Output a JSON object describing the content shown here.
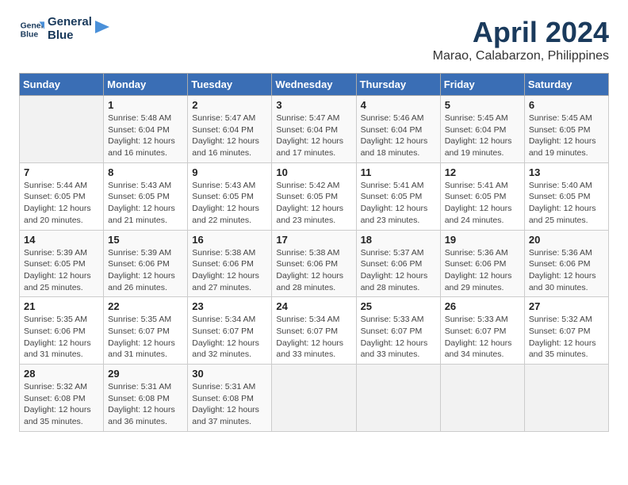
{
  "header": {
    "logo_line1": "General",
    "logo_line2": "Blue",
    "title": "April 2024",
    "subtitle": "Marao, Calabarzon, Philippines"
  },
  "calendar": {
    "days_of_week": [
      "Sunday",
      "Monday",
      "Tuesday",
      "Wednesday",
      "Thursday",
      "Friday",
      "Saturday"
    ],
    "weeks": [
      [
        {
          "day": "",
          "info": ""
        },
        {
          "day": "1",
          "info": "Sunrise: 5:48 AM\nSunset: 6:04 PM\nDaylight: 12 hours\nand 16 minutes."
        },
        {
          "day": "2",
          "info": "Sunrise: 5:47 AM\nSunset: 6:04 PM\nDaylight: 12 hours\nand 16 minutes."
        },
        {
          "day": "3",
          "info": "Sunrise: 5:47 AM\nSunset: 6:04 PM\nDaylight: 12 hours\nand 17 minutes."
        },
        {
          "day": "4",
          "info": "Sunrise: 5:46 AM\nSunset: 6:04 PM\nDaylight: 12 hours\nand 18 minutes."
        },
        {
          "day": "5",
          "info": "Sunrise: 5:45 AM\nSunset: 6:04 PM\nDaylight: 12 hours\nand 19 minutes."
        },
        {
          "day": "6",
          "info": "Sunrise: 5:45 AM\nSunset: 6:05 PM\nDaylight: 12 hours\nand 19 minutes."
        }
      ],
      [
        {
          "day": "7",
          "info": "Sunrise: 5:44 AM\nSunset: 6:05 PM\nDaylight: 12 hours\nand 20 minutes."
        },
        {
          "day": "8",
          "info": "Sunrise: 5:43 AM\nSunset: 6:05 PM\nDaylight: 12 hours\nand 21 minutes."
        },
        {
          "day": "9",
          "info": "Sunrise: 5:43 AM\nSunset: 6:05 PM\nDaylight: 12 hours\nand 22 minutes."
        },
        {
          "day": "10",
          "info": "Sunrise: 5:42 AM\nSunset: 6:05 PM\nDaylight: 12 hours\nand 23 minutes."
        },
        {
          "day": "11",
          "info": "Sunrise: 5:41 AM\nSunset: 6:05 PM\nDaylight: 12 hours\nand 23 minutes."
        },
        {
          "day": "12",
          "info": "Sunrise: 5:41 AM\nSunset: 6:05 PM\nDaylight: 12 hours\nand 24 minutes."
        },
        {
          "day": "13",
          "info": "Sunrise: 5:40 AM\nSunset: 6:05 PM\nDaylight: 12 hours\nand 25 minutes."
        }
      ],
      [
        {
          "day": "14",
          "info": "Sunrise: 5:39 AM\nSunset: 6:05 PM\nDaylight: 12 hours\nand 25 minutes."
        },
        {
          "day": "15",
          "info": "Sunrise: 5:39 AM\nSunset: 6:06 PM\nDaylight: 12 hours\nand 26 minutes."
        },
        {
          "day": "16",
          "info": "Sunrise: 5:38 AM\nSunset: 6:06 PM\nDaylight: 12 hours\nand 27 minutes."
        },
        {
          "day": "17",
          "info": "Sunrise: 5:38 AM\nSunset: 6:06 PM\nDaylight: 12 hours\nand 28 minutes."
        },
        {
          "day": "18",
          "info": "Sunrise: 5:37 AM\nSunset: 6:06 PM\nDaylight: 12 hours\nand 28 minutes."
        },
        {
          "day": "19",
          "info": "Sunrise: 5:36 AM\nSunset: 6:06 PM\nDaylight: 12 hours\nand 29 minutes."
        },
        {
          "day": "20",
          "info": "Sunrise: 5:36 AM\nSunset: 6:06 PM\nDaylight: 12 hours\nand 30 minutes."
        }
      ],
      [
        {
          "day": "21",
          "info": "Sunrise: 5:35 AM\nSunset: 6:06 PM\nDaylight: 12 hours\nand 31 minutes."
        },
        {
          "day": "22",
          "info": "Sunrise: 5:35 AM\nSunset: 6:07 PM\nDaylight: 12 hours\nand 31 minutes."
        },
        {
          "day": "23",
          "info": "Sunrise: 5:34 AM\nSunset: 6:07 PM\nDaylight: 12 hours\nand 32 minutes."
        },
        {
          "day": "24",
          "info": "Sunrise: 5:34 AM\nSunset: 6:07 PM\nDaylight: 12 hours\nand 33 minutes."
        },
        {
          "day": "25",
          "info": "Sunrise: 5:33 AM\nSunset: 6:07 PM\nDaylight: 12 hours\nand 33 minutes."
        },
        {
          "day": "26",
          "info": "Sunrise: 5:33 AM\nSunset: 6:07 PM\nDaylight: 12 hours\nand 34 minutes."
        },
        {
          "day": "27",
          "info": "Sunrise: 5:32 AM\nSunset: 6:07 PM\nDaylight: 12 hours\nand 35 minutes."
        }
      ],
      [
        {
          "day": "28",
          "info": "Sunrise: 5:32 AM\nSunset: 6:08 PM\nDaylight: 12 hours\nand 35 minutes."
        },
        {
          "day": "29",
          "info": "Sunrise: 5:31 AM\nSunset: 6:08 PM\nDaylight: 12 hours\nand 36 minutes."
        },
        {
          "day": "30",
          "info": "Sunrise: 5:31 AM\nSunset: 6:08 PM\nDaylight: 12 hours\nand 37 minutes."
        },
        {
          "day": "",
          "info": ""
        },
        {
          "day": "",
          "info": ""
        },
        {
          "day": "",
          "info": ""
        },
        {
          "day": "",
          "info": ""
        }
      ]
    ]
  }
}
